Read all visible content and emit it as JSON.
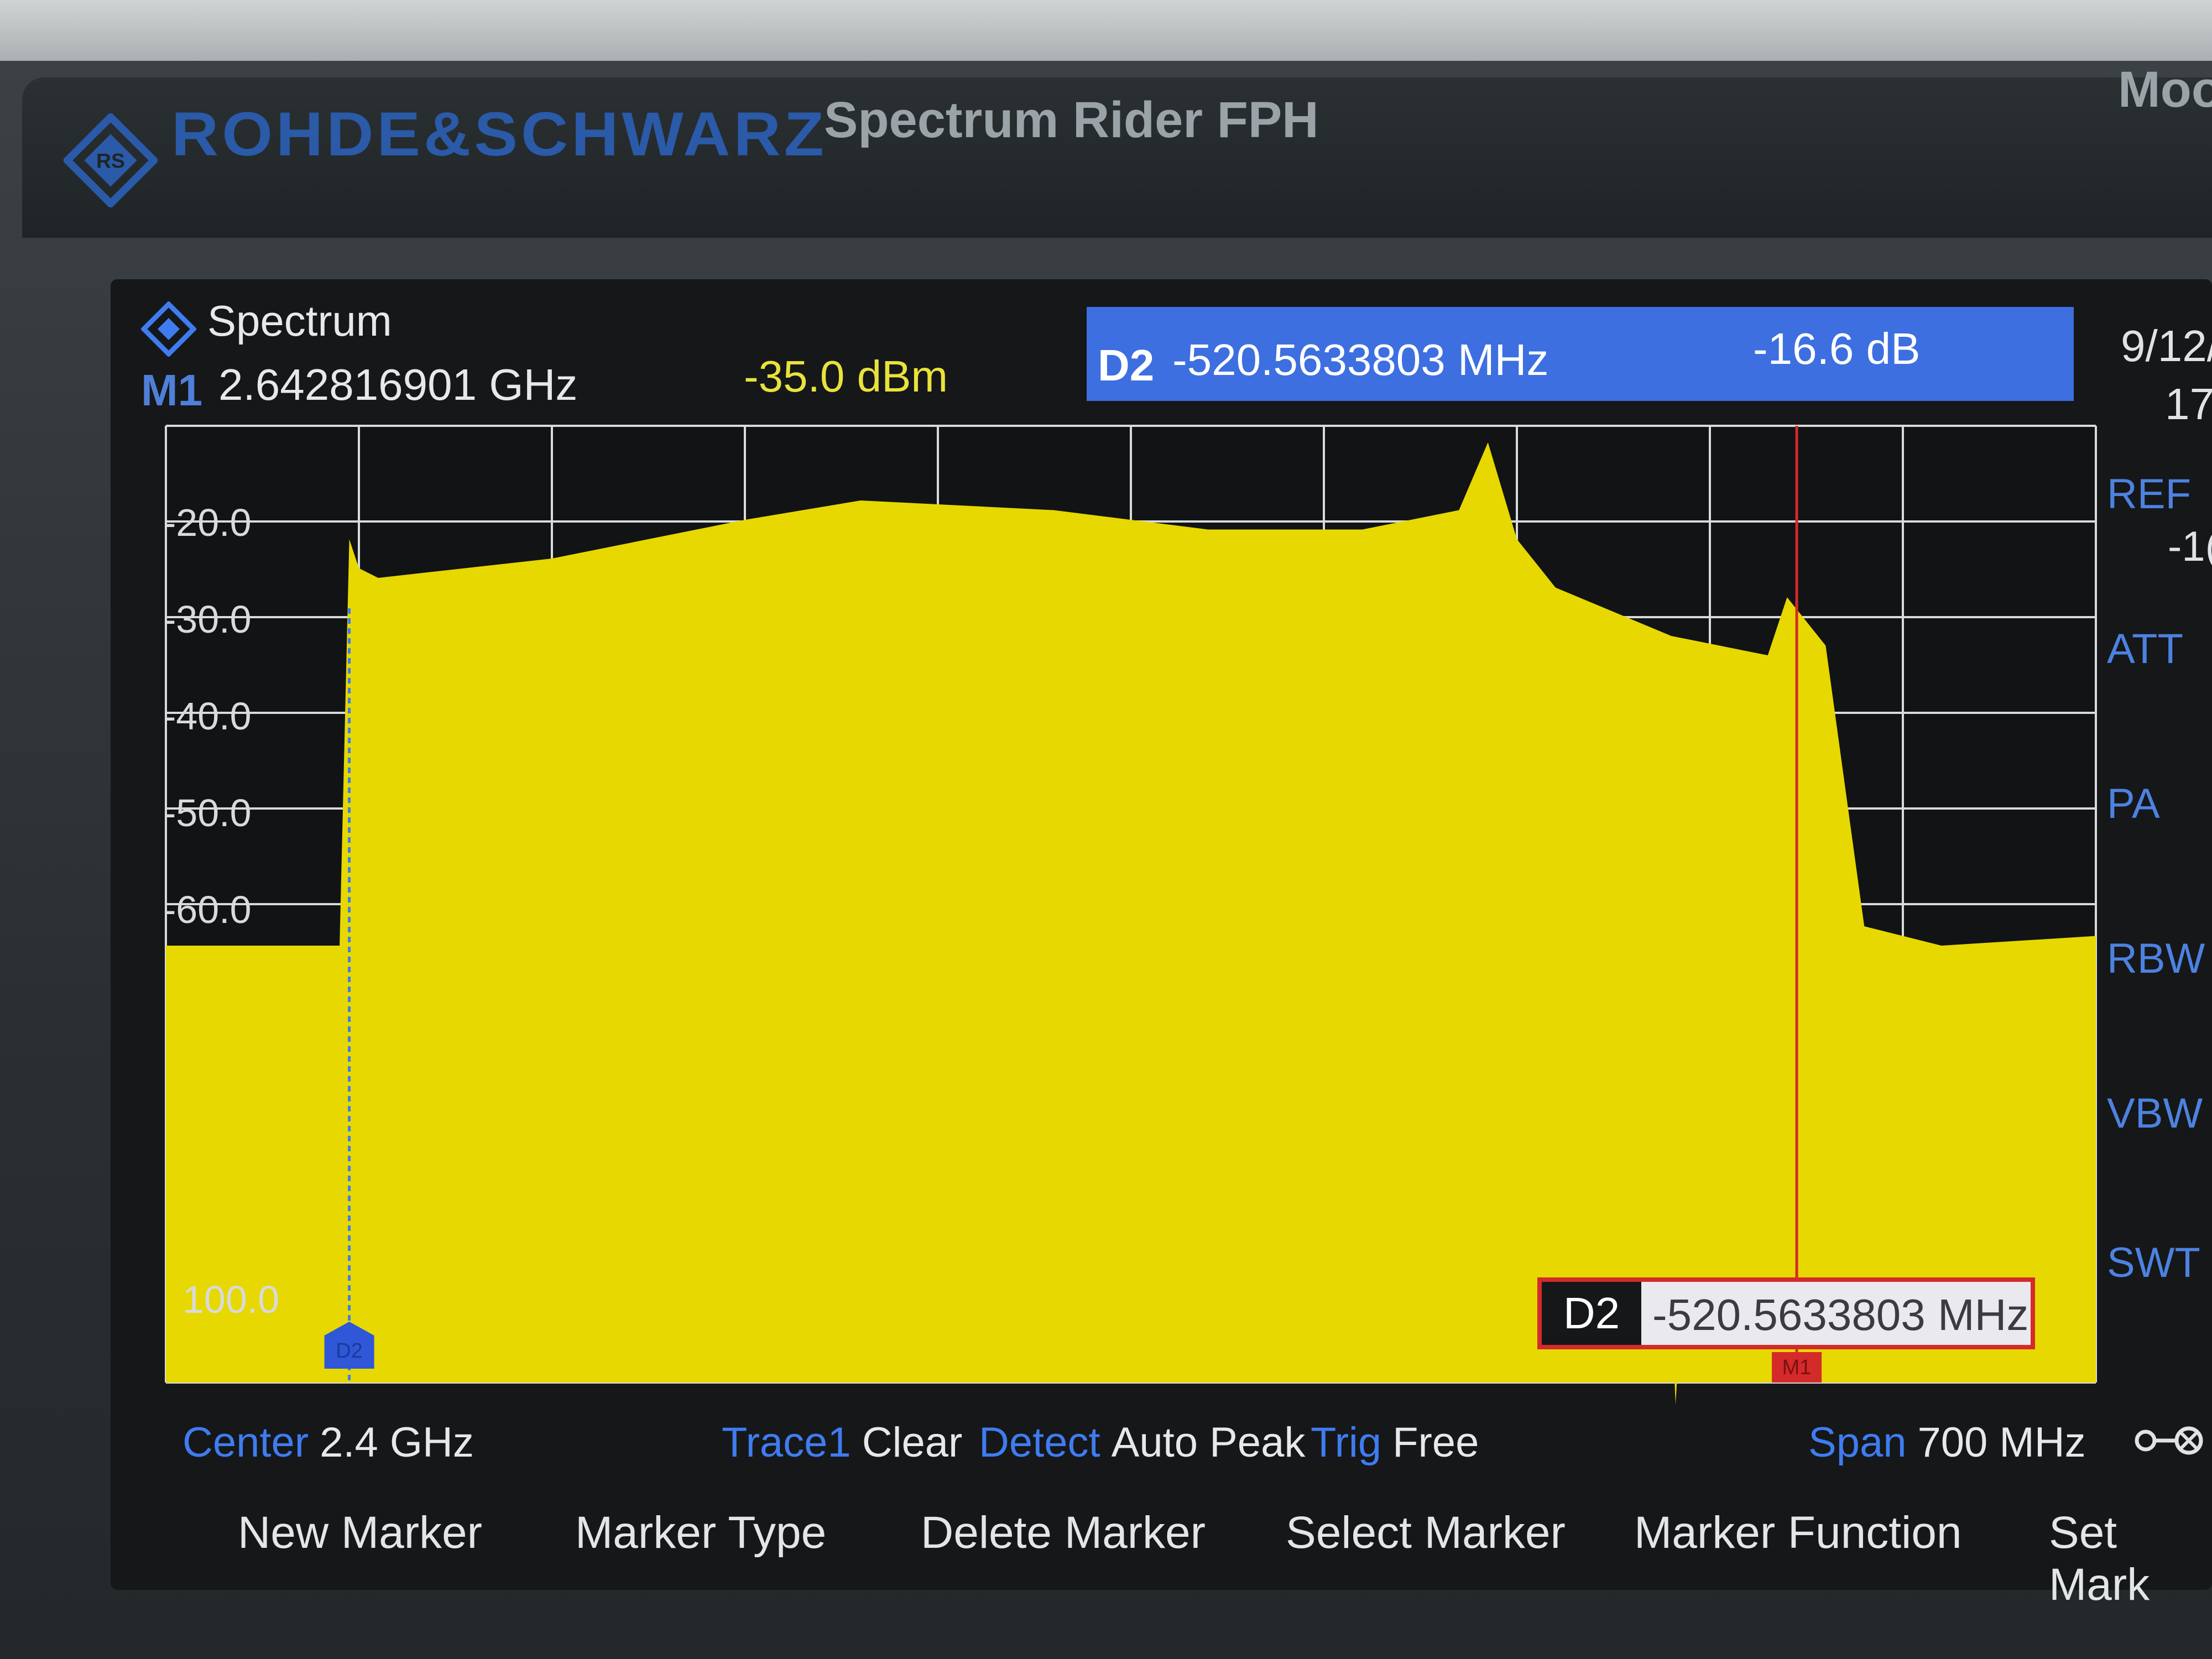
{
  "device": {
    "brand": "ROHDE&SCHWARZ",
    "model": "Spectrum Rider FPH",
    "mode_partial": "Moo"
  },
  "header": {
    "title": "Spectrum",
    "icon": "rs-diamond-icon",
    "marker1": {
      "label": "M1",
      "frequency": "2.642816901 GHz",
      "level": "-35.0 dBm"
    },
    "delta2": {
      "label": "D2",
      "frequency": "-520.5633803 MHz",
      "level": "-16.6 dB"
    },
    "date_partial": "9/12/",
    "time_partial": "17:"
  },
  "side_panel": {
    "items": [
      {
        "label": "REF",
        "value": "-1("
      },
      {
        "label": "ATT",
        "value": ""
      },
      {
        "label": "PA",
        "value": ""
      },
      {
        "label": "RBW",
        "value": ""
      },
      {
        "label": "VBW",
        "value": ""
      },
      {
        "label": "SWT",
        "value": ""
      }
    ]
  },
  "chart_data": {
    "type": "area",
    "title": "",
    "xlabel": "",
    "ylabel": "",
    "y_ticks": [
      "-20.0",
      "-30.0",
      "-40.0",
      "-50.0",
      "-60.0",
      "100.0"
    ],
    "grid": true,
    "fill_color": "#e6d800",
    "series": [
      {
        "x_fraction": [
          0.0,
          0.09,
          0.095,
          0.1,
          0.11,
          0.2,
          0.3,
          0.36,
          0.46,
          0.54,
          0.62,
          0.67,
          0.685,
          0.7,
          0.72,
          0.78,
          0.83,
          0.84,
          0.86,
          0.88,
          0.92,
          1.0
        ],
        "values": [
          -64,
          -64,
          -22,
          -25,
          -26,
          -24,
          -20,
          -18,
          -19,
          -21,
          -21,
          -19,
          -12,
          -22,
          -27,
          -32,
          -34,
          -28,
          -33,
          -62,
          -64,
          -63
        ]
      }
    ],
    "markers": [
      {
        "name": "D2",
        "x_fraction": 0.095
      },
      {
        "name": "M1",
        "x_fraction": 0.845
      }
    ]
  },
  "delta_box": {
    "tag": "D2",
    "value": "-520.5633803 MHz"
  },
  "marker_tags": {
    "d2": "D2",
    "m1": "M1"
  },
  "footer": {
    "center_key": "Center",
    "center_val": "2.4 GHz",
    "trace_key": "Trace1",
    "trace_val": "Clear",
    "detect_key": "Detect",
    "detect_val": "Auto Peak",
    "trig_key": "Trig",
    "trig_val": "Free",
    "span_key": "Span",
    "span_val": "700 MHz"
  },
  "softkeys": [
    "New Marker",
    "Marker Type",
    "Delete Marker",
    "Select Marker",
    "Marker Function",
    "Set Mark"
  ]
}
